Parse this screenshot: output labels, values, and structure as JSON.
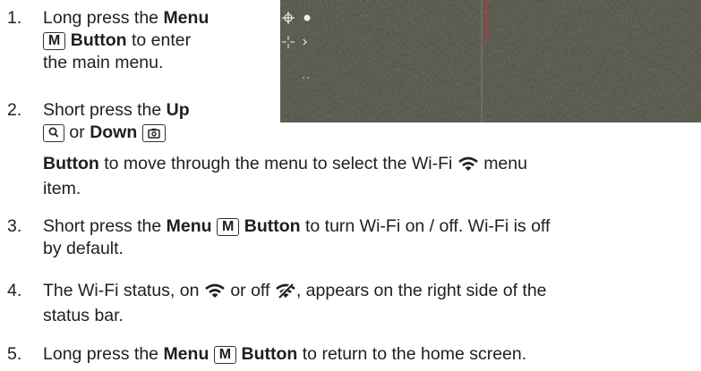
{
  "steps": [
    {
      "number": "1.",
      "line1_pre": "Long press the",
      "button": "Menu",
      "key": "M",
      "line2_post": "Button",
      "line2_rest": "to enter",
      "line3": "the main menu."
    },
    {
      "number": "2.",
      "line1_pre": "Short press the",
      "button_up": "Up",
      "or_text": "or",
      "button_down": "Down",
      "line3_button": "Button",
      "line3_rest": "to move through the menu to select the Wi-Fi",
      "line3_end": "menu",
      "line4": "item."
    },
    {
      "number": "3.",
      "pre": "Short press the",
      "button": "Menu",
      "key": "M",
      "button_word": "Button",
      "rest": "to turn Wi-Fi on / off. Wi-Fi is off",
      "line2": "by default."
    },
    {
      "number": "4.",
      "pre": "The Wi-Fi status, on",
      "mid": "or off",
      "rest": ", appears on the right side of the",
      "line2": "status bar."
    },
    {
      "number": "5.",
      "pre": "Long press the",
      "button": "Menu",
      "key": "M",
      "button_word": "Button",
      "rest": "to return to the home screen."
    }
  ],
  "colors": {
    "text": "#1f1f1f",
    "screen_bg": "#4a4a3f",
    "accent_red": "#e0282b",
    "accent_cyan": "#3fb8e0"
  }
}
